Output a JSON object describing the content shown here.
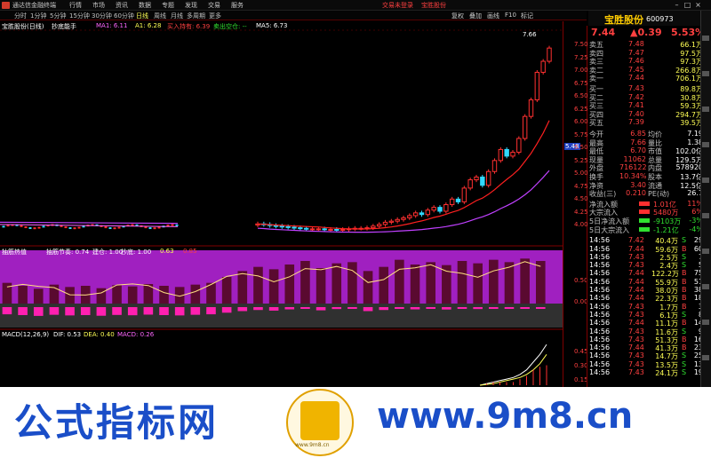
{
  "titlebar": {
    "app_title": "通达信金融终端",
    "menus": [
      "行情",
      "市场",
      "资讯",
      "数据",
      "专题",
      "发现",
      "交易",
      "服务"
    ],
    "alerts": [
      "交易未登录",
      "宝胜股份"
    ]
  },
  "toolbar": {
    "periods": [
      "分时",
      "1分钟",
      "5分钟",
      "15分钟",
      "30分钟",
      "60分钟",
      "日线",
      "周线",
      "月线",
      "多周期",
      "更多"
    ],
    "active_period": "日线",
    "right_buttons": [
      "复权",
      "叠加",
      "画线",
      "F10",
      "标记"
    ]
  },
  "stock": {
    "name": "宝胜股份",
    "code": "600973",
    "price": "7.44",
    "change": "▲0.39",
    "change_pct": "5.53%"
  },
  "main_chart": {
    "label": "宝胜股份(日线)",
    "indicator_name": "抄底能手",
    "ma1": "MA1: 6.11",
    "a1": "A1: 6.28",
    "buy_signal": "买入持有: 6.39",
    "sell_signal": "卖出空仓: --",
    "ma5": "MA5: 6.73",
    "price_labels": [
      "7.66",
      "5.48"
    ],
    "yticks": [
      "7.50",
      "7.25",
      "7.00",
      "6.75",
      "6.50",
      "6.25",
      "6.00",
      "5.75",
      "5.50",
      "5.25",
      "5.00",
      "4.75",
      "4.50",
      "4.25",
      "4.00"
    ]
  },
  "chart_data": [
    {
      "type": "line",
      "title": "宝胜股份(日线)",
      "ylim": [
        3.9,
        7.7
      ],
      "series": [
        {
          "name": "close",
          "values": [
            4.25,
            4.24,
            4.22,
            4.21,
            4.2,
            4.19,
            4.18,
            4.17,
            4.16,
            4.16,
            4.16,
            4.15,
            4.15,
            4.14,
            4.15,
            4.16,
            4.17,
            4.17,
            4.18,
            4.21,
            4.24,
            4.28,
            4.3,
            4.33,
            4.36,
            4.4,
            4.45,
            4.42,
            4.5,
            4.55,
            4.48,
            4.6,
            4.7,
            4.65,
            4.9,
            5.05,
            5.1,
            4.95,
            5.2,
            5.4,
            5.6,
            5.48,
            5.55,
            5.8,
            6.2,
            6.5,
            7.0,
            7.2,
            7.44
          ]
        }
      ]
    },
    {
      "type": "bar",
      "title": "抽筋热值",
      "ylim": [
        -0.6,
        0.9
      ],
      "series": [
        {
          "name": "强势",
          "values": [
            0.35,
            0.3,
            0.25,
            0.32,
            0.28,
            0.3,
            0.26,
            0.31,
            0.29,
            0.33,
            0.3,
            0.28,
            0.32,
            0.35,
            0.45,
            0.55,
            0.62,
            0.58,
            0.66,
            0.72,
            0.6,
            0.68,
            0.7,
            0.55,
            0.62,
            0.74,
            0.66,
            0.7,
            0.65,
            0.72,
            0.68,
            0.74,
            0.7,
            0.76,
            0.72
          ]
        }
      ]
    },
    {
      "type": "line",
      "title": "MACD(12,26,9)",
      "series": [
        {
          "name": "DIF",
          "values": [
            0.0,
            0.02,
            0.04,
            0.06,
            0.08,
            0.1,
            0.14,
            0.2,
            0.3,
            0.4,
            0.53
          ]
        },
        {
          "name": "DEA",
          "values": [
            0.0,
            0.01,
            0.02,
            0.04,
            0.06,
            0.08,
            0.1,
            0.14,
            0.2,
            0.28,
            0.4
          ]
        }
      ]
    }
  ],
  "sub1": {
    "name": "抽筋热值",
    "label_a": "抽筋节奏: 0.74",
    "label_b": "建仓: 1.00",
    "label_c": "抄底: 1.00",
    "label_d": "0.63",
    "label_e": "0.85",
    "yticks": [
      "0.50",
      "0.00"
    ]
  },
  "sub2": {
    "name": "MACD(12,26,9)",
    "dif": "DIF: 0.53",
    "dea": "DEA: 0.40",
    "macd": "MACD: 0.26",
    "yticks": [
      "0.45",
      "0.30",
      "0.15"
    ]
  },
  "order_book": {
    "sell": [
      {
        "label": "卖五",
        "price": "7.48",
        "vol": "66.1万"
      },
      {
        "label": "卖四",
        "price": "7.47",
        "vol": "97.5万"
      },
      {
        "label": "卖三",
        "price": "7.46",
        "vol": "97.3万"
      },
      {
        "label": "卖二",
        "price": "7.45",
        "vol": "266.8万"
      },
      {
        "label": "卖一",
        "price": "7.44",
        "vol": "706.1万"
      }
    ],
    "buy": [
      {
        "label": "买一",
        "price": "7.43",
        "vol": "89.8万"
      },
      {
        "label": "买二",
        "price": "7.42",
        "vol": "30.8万"
      },
      {
        "label": "买三",
        "price": "7.41",
        "vol": "59.3万"
      },
      {
        "label": "买四",
        "price": "7.40",
        "vol": "294.7万"
      },
      {
        "label": "买五",
        "price": "7.39",
        "vol": "39.5万"
      }
    ]
  },
  "quote": [
    {
      "l1": "今开",
      "v1": "6.85",
      "l2": "均价",
      "v2": "7.19"
    },
    {
      "l1": "最高",
      "v1": "7.66",
      "l2": "量比",
      "v2": "1.38"
    },
    {
      "l1": "最低",
      "v1": "6.70",
      "l2": "市值",
      "v2": "102.0亿"
    },
    {
      "l1": "现量",
      "v1": "11062",
      "l2": "总量",
      "v2": "129.5万"
    },
    {
      "l1": "外盘",
      "v1": "716122",
      "l2": "内盘",
      "v2": "578920"
    },
    {
      "l1": "换手",
      "v1": "10.34%",
      "l2": "股本",
      "v2": "13.7亿"
    },
    {
      "l1": "净资",
      "v1": "3.40",
      "l2": "流通",
      "v2": "12.5亿"
    },
    {
      "l1": "收益(三)",
      "v1": "0.210",
      "l2": "PE(动)",
      "v2": "26.7"
    }
  ],
  "flows": [
    {
      "label": "净流入额",
      "val": "1.01亿",
      "pct": "11%"
    },
    {
      "label": "大宗流入",
      "val": "5480万",
      "pct": "6%"
    },
    {
      "label": "5日净流入额",
      "val": "-9103万",
      "pct": "-3%"
    },
    {
      "label": "5日大宗流入",
      "val": "-1.21亿",
      "pct": "-4%"
    }
  ],
  "trades": [
    {
      "t": "14:56",
      "p": "7.42",
      "v": "40.4万",
      "s": "S",
      "n": "29"
    },
    {
      "t": "14:56",
      "p": "7.44",
      "v": "59.6万",
      "s": "B",
      "n": "60"
    },
    {
      "t": "14:56",
      "p": "7.43",
      "v": "2.5万",
      "s": "S",
      "n": "7"
    },
    {
      "t": "14:56",
      "p": "7.43",
      "v": "2.4万",
      "s": "S",
      "n": "5"
    },
    {
      "t": "14:56",
      "p": "7.44",
      "v": "122.2万",
      "s": "B",
      "n": "75"
    },
    {
      "t": "14:56",
      "p": "7.44",
      "v": "55.9万",
      "s": "B",
      "n": "51"
    },
    {
      "t": "14:56",
      "p": "7.44",
      "v": "38.0万",
      "s": "B",
      "n": "38"
    },
    {
      "t": "14:56",
      "p": "7.44",
      "v": "22.3万",
      "s": "B",
      "n": "18"
    },
    {
      "t": "14:56",
      "p": "7.43",
      "v": "1.7万",
      "s": "B",
      "n": "3"
    },
    {
      "t": "14:56",
      "p": "7.43",
      "v": "6.1万",
      "s": "S",
      "n": "8"
    },
    {
      "t": "14:56",
      "p": "7.44",
      "v": "11.1万",
      "s": "B",
      "n": "14"
    },
    {
      "t": "14:56",
      "p": "7.43",
      "v": "11.6万",
      "s": "S",
      "n": "9"
    },
    {
      "t": "14:56",
      "p": "7.43",
      "v": "51.3万",
      "s": "B",
      "n": "16"
    },
    {
      "t": "14:56",
      "p": "7.44",
      "v": "41.3万",
      "s": "B",
      "n": "23"
    },
    {
      "t": "14:56",
      "p": "7.43",
      "v": "14.7万",
      "s": "S",
      "n": "25"
    },
    {
      "t": "14:56",
      "p": "7.43",
      "v": "13.5万",
      "s": "S",
      "n": "13"
    },
    {
      "t": "14:56",
      "p": "7.43",
      "v": "24.1万",
      "s": "S",
      "n": "19"
    }
  ],
  "watermark": {
    "left": "公式指标网",
    "right": "www.9m8.cn",
    "badge": "www.9m8.cn"
  }
}
